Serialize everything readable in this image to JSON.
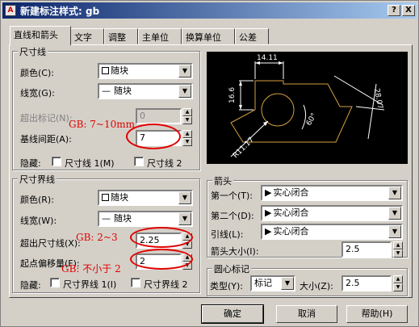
{
  "window": {
    "title": "新建标注样式: gb",
    "help_btn": "?",
    "close_btn": "X"
  },
  "tabs": [
    "直线和箭头",
    "文字",
    "调整",
    "主单位",
    "换算单位",
    "公差"
  ],
  "dimension_lines": {
    "title": "尺寸线",
    "color_label": "颜色(C):",
    "color_value": "随块",
    "lineweight_label": "线宽(G):",
    "lineweight_value": "随块",
    "extend_beyond_ticks_label": "超出标记(N):",
    "extend_beyond_ticks_value": "0",
    "baseline_spacing_label": "基线间距(A):",
    "baseline_spacing_value": "7",
    "suppress_label": "隐藏:",
    "suppress_dim1": "尺寸线 1(M)",
    "suppress_dim2": "尺寸线 2"
  },
  "extension_lines": {
    "title": "尺寸界线",
    "color_label": "颜色(R):",
    "color_value": "随块",
    "lineweight_label": "线宽(W):",
    "lineweight_value": "随块",
    "extend_beyond_dim_label": "超出尺寸线(X):",
    "extend_beyond_dim_value": "2.25",
    "offset_from_origin_label": "起点偏移量(F):",
    "offset_from_origin_value": "2",
    "suppress_label": "隐藏:",
    "suppress_ext1": "尺寸界线 1(I)",
    "suppress_ext2": "尺寸界线 2"
  },
  "arrowheads": {
    "title": "箭头",
    "first_label": "第一个(T):",
    "first_value": "实心闭合",
    "second_label": "第二个(D):",
    "second_value": "实心闭合",
    "leader_label": "引线(L):",
    "leader_value": "实心闭合",
    "size_label": "箭头大小(I):",
    "size_value": "2.5"
  },
  "center_marks": {
    "title": "圆心标记",
    "type_label": "类型(Y):",
    "type_value": "标记",
    "size_label": "大小(Z):",
    "size_value": "2.5"
  },
  "annotations": {
    "baseline_note": "GB: 7~10mm",
    "extend_note": "GB: 2~3",
    "offset_note": "GB: 不小于 2"
  },
  "preview": {
    "dim_top": "14.11",
    "dim_left": "16.6",
    "dim_right": "28.07",
    "dim_angle": "60°",
    "dim_radius": "R11.17"
  },
  "buttons": {
    "ok": "确定",
    "cancel": "取消",
    "help": "帮助(H)"
  },
  "colors": {
    "annotation_red": "#e00000",
    "preview_shape": "#d4a040",
    "preview_dims": "#ffffff"
  }
}
